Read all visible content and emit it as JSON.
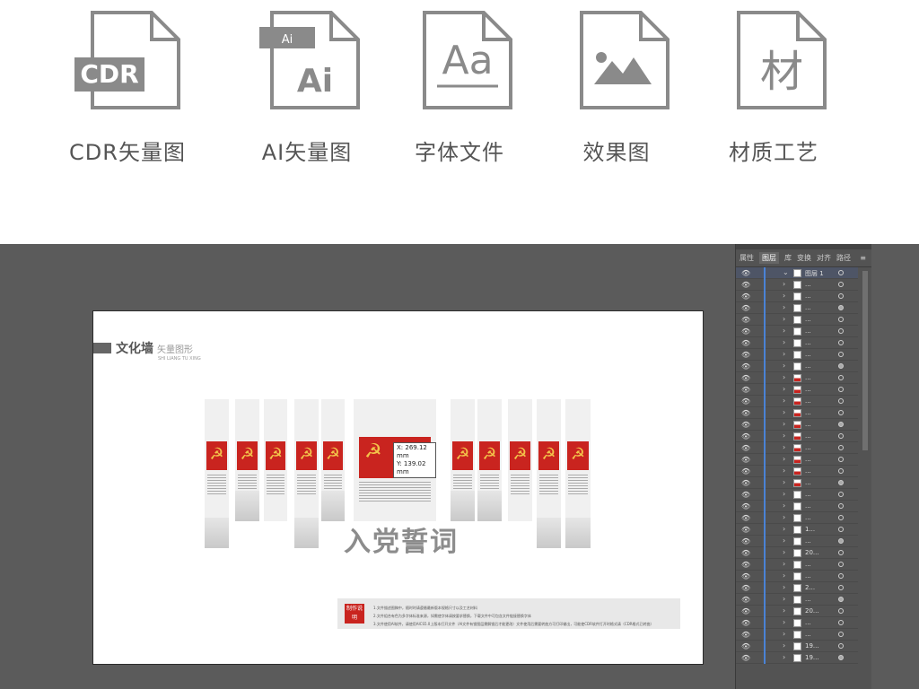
{
  "features": [
    {
      "icon": "cdr-file-icon",
      "badge": "CDR",
      "label": "CDR矢量图"
    },
    {
      "icon": "ai-file-icon",
      "badge": "Ai",
      "label": "AI矢量图"
    },
    {
      "icon": "font-file-icon",
      "badge": "Aa",
      "label": "字体文件"
    },
    {
      "icon": "image-file-icon",
      "badge": "",
      "label": "效果图"
    },
    {
      "icon": "material-file-icon",
      "badge": "材",
      "label": "材质工艺"
    }
  ],
  "artboard": {
    "title": "文化墙",
    "subtitle": "矢量图形",
    "pinyin": "SHI LIANG TU XING",
    "headline": "入党誓词",
    "coord_x": "X: 269.12 mm",
    "coord_y": "Y: 139.02 mm",
    "note_badge": "制作说明",
    "note_lines": [
      "1.文件描述图稿中，随时时请遵循最新版本规格尺寸以及工艺材料",
      "2.文件组合有色为多字体标准来源，如需使字体请按要求替换，下载文件中可包含文件链接替换字体",
      "3.文件使用AI软件，请使用AICS5.0上版本打开文件（AI文件有锁图层需解锁后才能更改）文件使用后需要转曲方可打印输出，可能使CDR软件打开时格式请（CDR格式已转曲）"
    ]
  },
  "layers_panel": {
    "tabs": [
      "属性",
      "图层",
      "库",
      "变换",
      "对齐",
      "路径"
    ],
    "active_tab": "图层",
    "rows": [
      {
        "name": "图层 1",
        "thumb": "plain"
      },
      {
        "name": "...",
        "thumb": "plain"
      },
      {
        "name": "...",
        "thumb": "plain"
      },
      {
        "name": "...",
        "thumb": "plain"
      },
      {
        "name": "...",
        "thumb": "plain"
      },
      {
        "name": "...",
        "thumb": "plain"
      },
      {
        "name": "...",
        "thumb": "plain"
      },
      {
        "name": "...",
        "thumb": "plain"
      },
      {
        "name": "...",
        "thumb": "plain"
      },
      {
        "name": "...",
        "thumb": "red"
      },
      {
        "name": "...",
        "thumb": "red"
      },
      {
        "name": "...",
        "thumb": "red"
      },
      {
        "name": "...",
        "thumb": "red"
      },
      {
        "name": "...",
        "thumb": "red"
      },
      {
        "name": "...",
        "thumb": "red"
      },
      {
        "name": "...",
        "thumb": "red"
      },
      {
        "name": "...",
        "thumb": "red"
      },
      {
        "name": "...",
        "thumb": "red"
      },
      {
        "name": "...",
        "thumb": "red"
      },
      {
        "name": "...",
        "thumb": "plain"
      },
      {
        "name": "...",
        "thumb": "plain"
      },
      {
        "name": "...",
        "thumb": "plain"
      },
      {
        "name": "1...",
        "thumb": "plain"
      },
      {
        "name": "...",
        "thumb": "plain"
      },
      {
        "name": "20...",
        "thumb": "plain"
      },
      {
        "name": "...",
        "thumb": "plain"
      },
      {
        "name": "...",
        "thumb": "plain"
      },
      {
        "name": "2...",
        "thumb": "plain"
      },
      {
        "name": "...",
        "thumb": "plain"
      },
      {
        "name": "20...",
        "thumb": "plain"
      },
      {
        "name": "...",
        "thumb": "plain"
      },
      {
        "name": "...",
        "thumb": "plain"
      },
      {
        "name": "19...",
        "thumb": "plain"
      },
      {
        "name": "19...",
        "thumb": "plain"
      }
    ]
  },
  "colors": {
    "brand_red": "#c9241f",
    "workspace": "#5b5b5b",
    "panel": "#535353",
    "layer_accent": "#4a83d6"
  }
}
